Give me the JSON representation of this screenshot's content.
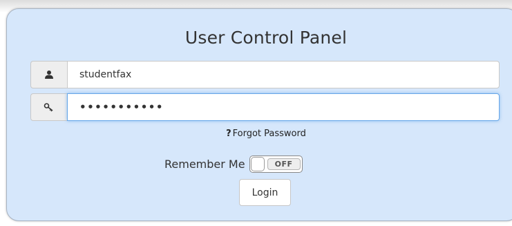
{
  "panel": {
    "title": "User Control Panel"
  },
  "username": {
    "icon": "user-icon",
    "value": "studentfax"
  },
  "password": {
    "icon": "key-icon",
    "value": "•••••••••••"
  },
  "forgot": {
    "prefix": "?",
    "label": "Forgot Password"
  },
  "remember": {
    "label": "Remember Me",
    "toggle_state": "OFF"
  },
  "login": {
    "label": "Login"
  },
  "colors": {
    "panel_bg": "#d6e7fb",
    "focus_border": "#66a6e8"
  }
}
